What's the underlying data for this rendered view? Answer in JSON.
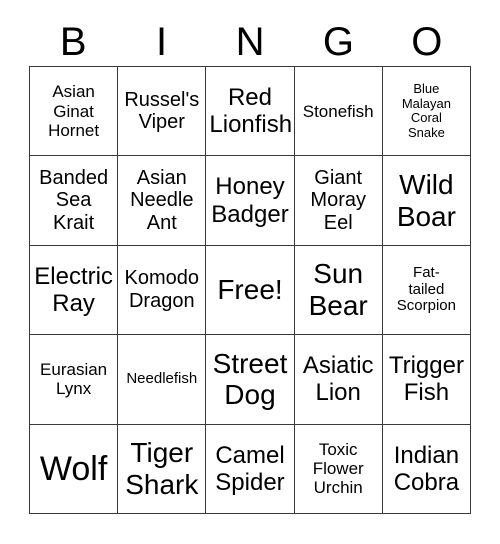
{
  "card": {
    "header_letters": [
      "B",
      "I",
      "N",
      "G",
      "O"
    ],
    "columns": 5,
    "rows": 5,
    "colors": {
      "background": "#ffffff",
      "text": "#000000",
      "grid_line": "#3a3a3a"
    },
    "cells": [
      {
        "text": "Asian\nGinat\nHornet",
        "size": "fs-md"
      },
      {
        "text": "Russel's\nViper",
        "size": "fs-lg"
      },
      {
        "text": "Red\nLionfish",
        "size": "fs-xl"
      },
      {
        "text": "Stonefish",
        "size": "fs-md"
      },
      {
        "text": "Blue\nMalayan\nCoral\nSnake",
        "size": "fs-xs"
      },
      {
        "text": "Banded\nSea\nKrait",
        "size": "fs-lg"
      },
      {
        "text": "Asian\nNeedle\nAnt",
        "size": "fs-lg"
      },
      {
        "text": "Honey\nBadger",
        "size": "fs-xl"
      },
      {
        "text": "Giant\nMoray\nEel",
        "size": "fs-lg"
      },
      {
        "text": "Wild\nBoar",
        "size": "fs-xxl"
      },
      {
        "text": "Electric\nRay",
        "size": "fs-xl"
      },
      {
        "text": "Komodo\nDragon",
        "size": "fs-lg"
      },
      {
        "text": "Free!",
        "size": "fs-xxl"
      },
      {
        "text": "Sun\nBear",
        "size": "fs-xxl"
      },
      {
        "text": "Fat-\ntailed\nScorpion",
        "size": "fs-sm"
      },
      {
        "text": "Eurasian\nLynx",
        "size": "fs-md"
      },
      {
        "text": "Needlefish",
        "size": "fs-sm"
      },
      {
        "text": "Street\nDog",
        "size": "fs-xxl"
      },
      {
        "text": "Asiatic\nLion",
        "size": "fs-xl"
      },
      {
        "text": "Trigger\nFish",
        "size": "fs-xl"
      },
      {
        "text": "Wolf",
        "size": "fs-huge"
      },
      {
        "text": "Tiger\nShark",
        "size": "fs-xxl"
      },
      {
        "text": "Camel\nSpider",
        "size": "fs-xl"
      },
      {
        "text": "Toxic\nFlower\nUrchin",
        "size": "fs-md"
      },
      {
        "text": "Indian\nCobra",
        "size": "fs-xl"
      }
    ]
  }
}
